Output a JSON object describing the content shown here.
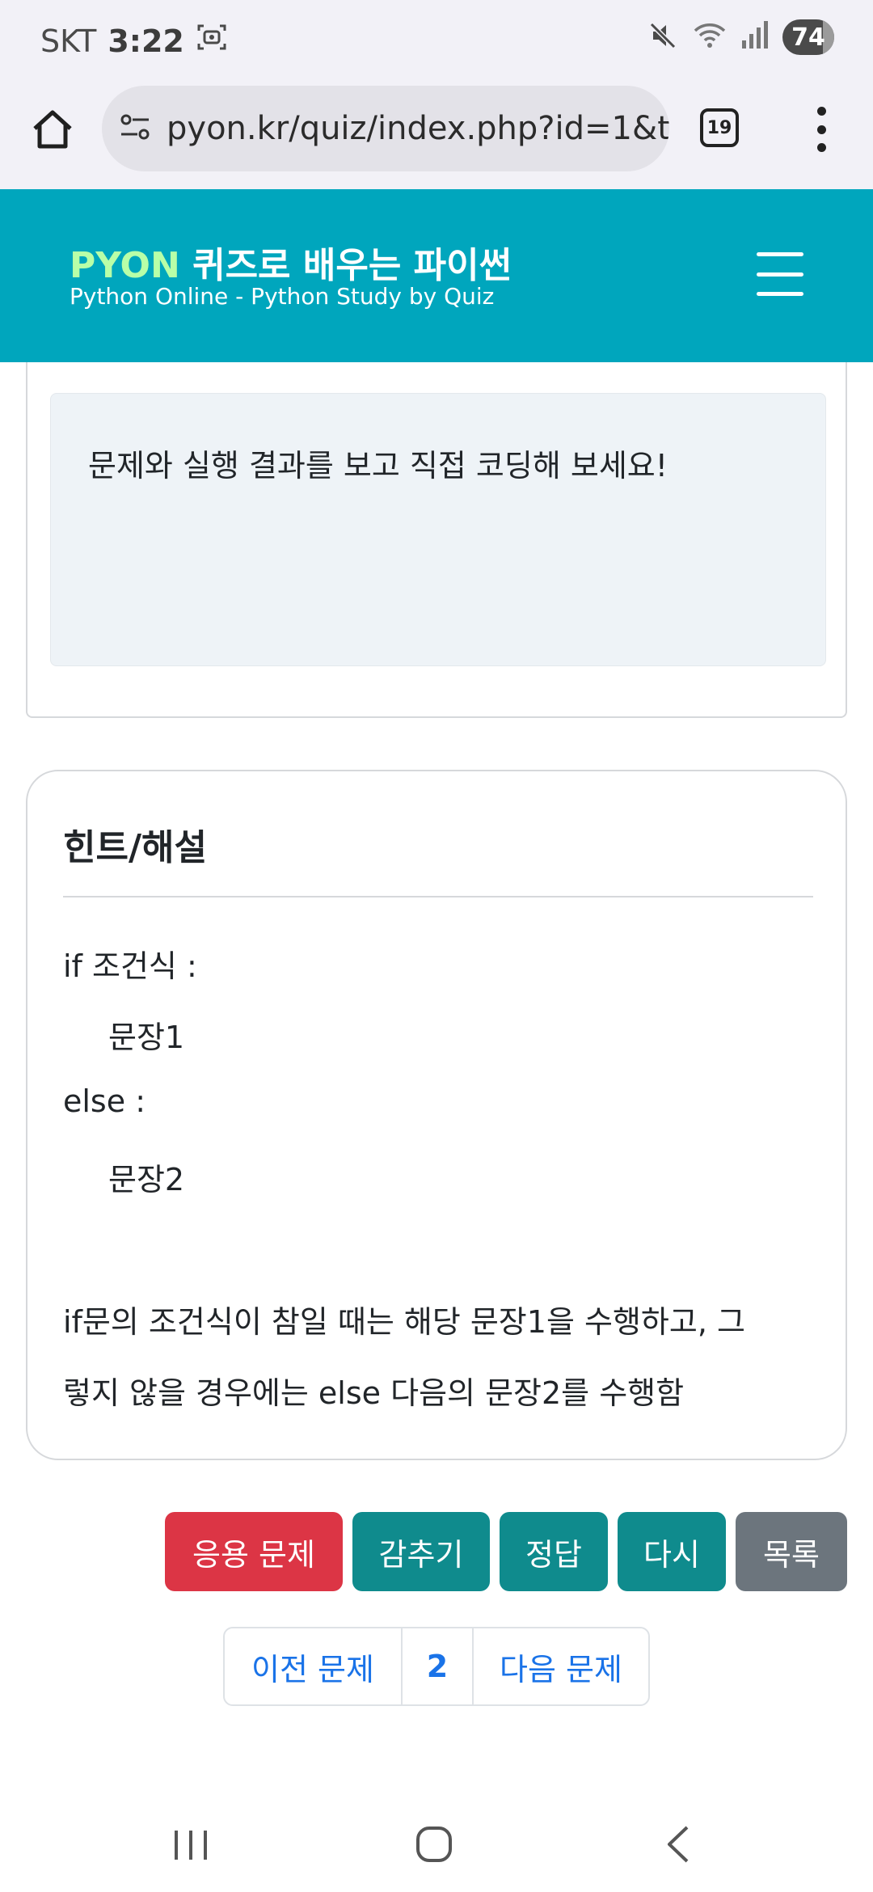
{
  "status_bar": {
    "carrier": "SKT",
    "time": "3:22",
    "battery": "74",
    "icons": [
      "screenshot-icon",
      "mute-icon",
      "wifi-icon",
      "signal-icon",
      "battery-icon"
    ]
  },
  "browser": {
    "url": "pyon.kr/quiz/index.php?id=1&ty",
    "tab_count": "19",
    "icons": [
      "home-icon",
      "site-settings-icon",
      "tabs-icon",
      "more-icon"
    ]
  },
  "site_header": {
    "logo_brand": "PYON",
    "logo_title": " 퀴즈로 배우는 파이썬",
    "logo_subtitle": "Python Online - Python Study by Quiz",
    "colors": {
      "header_bg": "#00a6bd",
      "brand": "#b8ffa8"
    }
  },
  "question": {
    "text": "문제와 실행 결과를 보고 직접 코딩해 보세요!"
  },
  "hint": {
    "title": "힌트/해설",
    "lines": [
      "if 조건식 :",
      "문장1",
      "else :",
      "문장2",
      "if문의 조건식이 참일 때는 해당 문장1을 수행하고, 그",
      "렇지 않을 경우에는 else 다음의 문장2를 수행함"
    ]
  },
  "actions": {
    "apply": "응용 문제",
    "hide": "감추기",
    "answer": "정답",
    "retry": "다시",
    "list": "목록",
    "colors": {
      "red": "#dc3545",
      "teal": "#0f8b8d",
      "gray": "#6c757d"
    }
  },
  "pagination": {
    "prev": "이전 문제",
    "current": "2",
    "next": "다음 문제"
  },
  "nav_bar": {
    "icons": [
      "recent-apps-icon",
      "home-circle-icon",
      "back-icon"
    ]
  }
}
